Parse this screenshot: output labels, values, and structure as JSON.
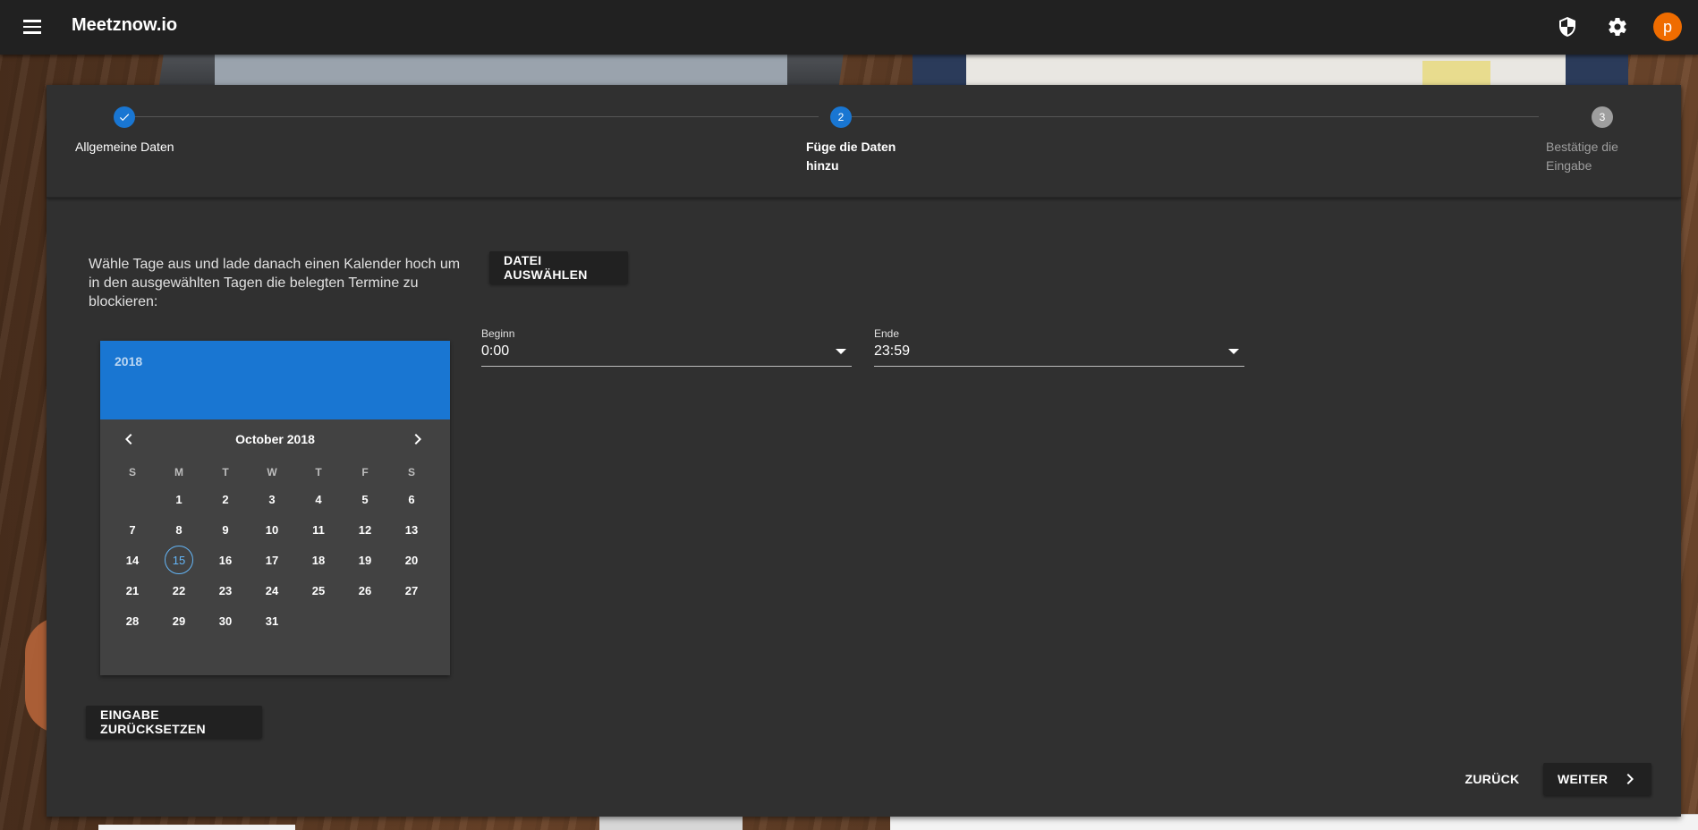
{
  "app": {
    "title": "Meetznow.io",
    "avatar_letter": "p",
    "avatar_color": "#ef6c00",
    "icons": [
      "menu-icon",
      "shield-icon",
      "gear-icon"
    ]
  },
  "stepper": {
    "steps": [
      {
        "number": "✓",
        "label": "Allgemeine Daten",
        "state": "completed"
      },
      {
        "number": "2",
        "label_line1": "Füge die Daten",
        "label_line2": "hinzu",
        "state": "active"
      },
      {
        "number": "3",
        "label_line1": "Bestätige die",
        "label_line2": "Eingabe",
        "state": "pending"
      }
    ],
    "accent_color": "#1976d2"
  },
  "content": {
    "instructions": "Wähle Tage aus und lade danach einen Kalender hoch um in den ausgewählten Tagen die belegten Termine zu blockieren:",
    "file_button": "DATEI AUSWÄHLEN",
    "reset_button": "EINGABE ZURÜCKSETZEN"
  },
  "calendar": {
    "year": "2018",
    "month_label": "October 2018",
    "weekdays": [
      "S",
      "M",
      "T",
      "W",
      "T",
      "F",
      "S"
    ],
    "weeks": [
      [
        "",
        "1",
        "2",
        "3",
        "4",
        "5",
        "6"
      ],
      [
        "7",
        "8",
        "9",
        "10",
        "11",
        "12",
        "13"
      ],
      [
        "14",
        "15",
        "16",
        "17",
        "18",
        "19",
        "20"
      ],
      [
        "21",
        "22",
        "23",
        "24",
        "25",
        "26",
        "27"
      ],
      [
        "28",
        "29",
        "30",
        "31",
        "",
        "",
        ""
      ]
    ],
    "today": "15"
  },
  "time": {
    "begin": {
      "label": "Beginn",
      "value": "0:00"
    },
    "end": {
      "label": "Ende",
      "value": "23:59"
    }
  },
  "footer": {
    "back_button": "ZURÜCK",
    "next_button": "WEITER"
  }
}
